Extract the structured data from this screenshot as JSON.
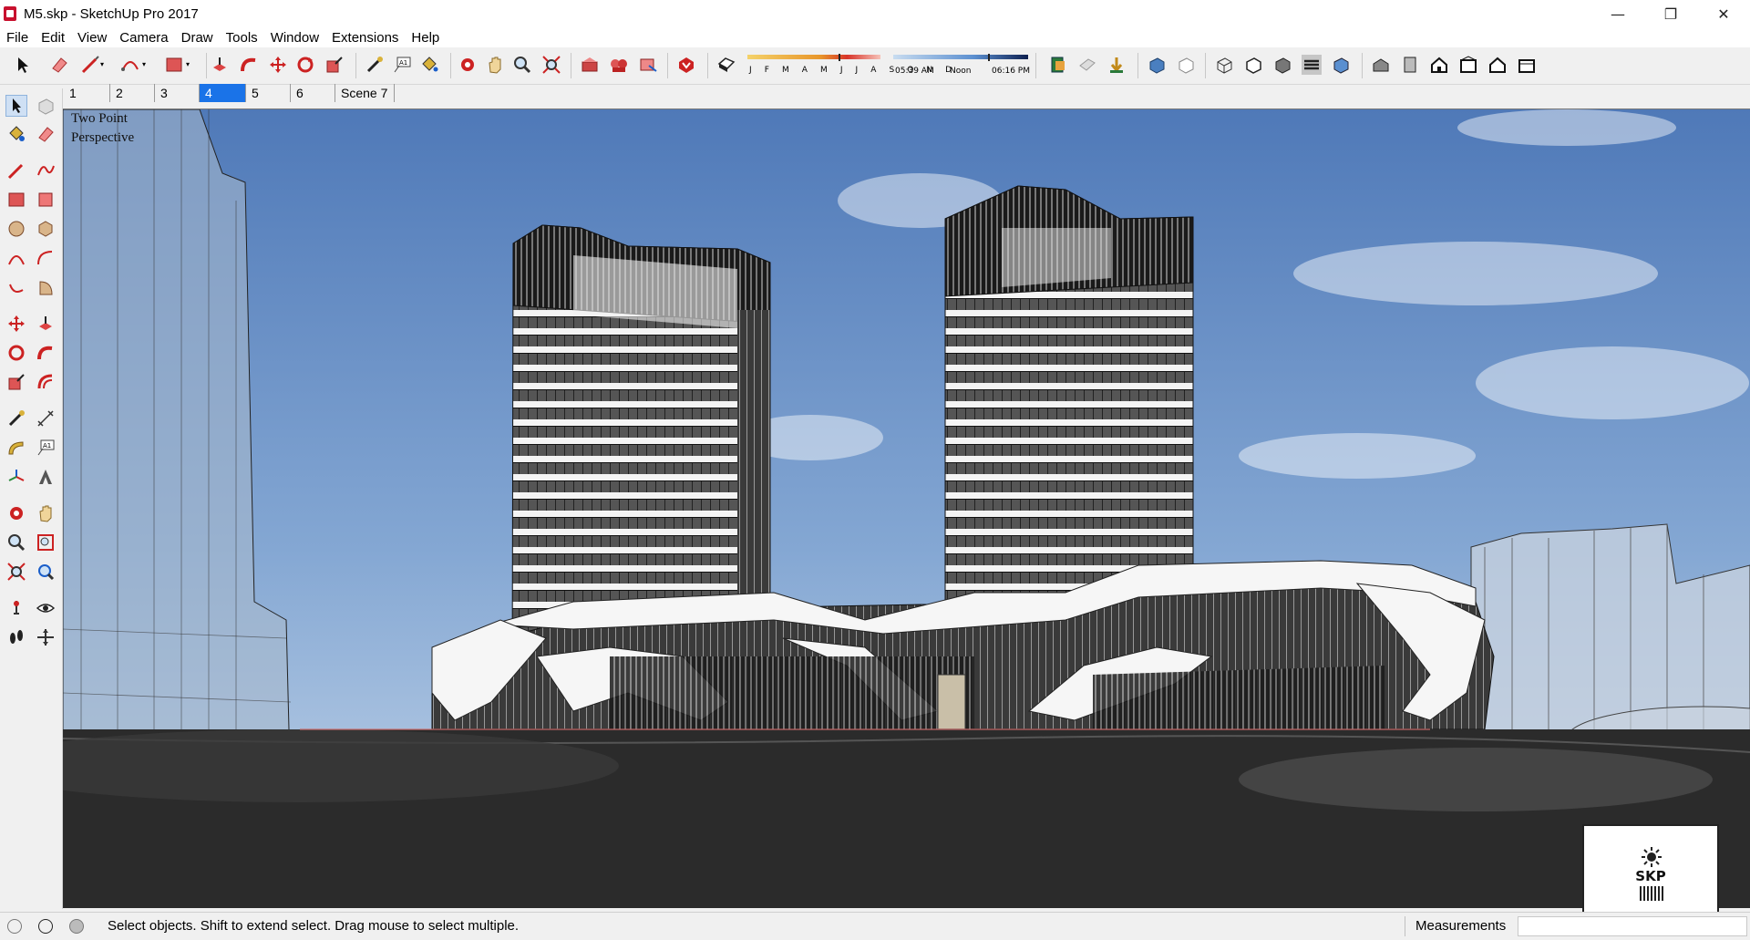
{
  "window": {
    "title": "M5.skp - SketchUp Pro 2017",
    "controls": [
      "—",
      "❐",
      "✕"
    ]
  },
  "menu": [
    "File",
    "Edit",
    "View",
    "Camera",
    "Draw",
    "Tools",
    "Window",
    "Extensions",
    "Help"
  ],
  "shadow": {
    "months": "J F M A M J J A S O N D",
    "time_start": "05:39 AM",
    "time_mid": "Noon",
    "time_end": "06:16 PM"
  },
  "scenes": {
    "tabs": [
      "1",
      "2",
      "3",
      "4",
      "5",
      "6",
      "Scene 7"
    ],
    "active": "4"
  },
  "viewport": {
    "camera_label_line1": "Two Point",
    "camera_label_line2": "Perspective"
  },
  "status": {
    "hint": "Select objects. Shift to extend select. Drag mouse to select multiple.",
    "measurements_label": "Measurements",
    "measurements_value": ""
  },
  "badge": {
    "text": "SKP"
  },
  "colors": {
    "accent": "#1a73e8",
    "sketchup_red": "#c8102e",
    "sky_top": "#4f79b8",
    "sky_bottom": "#b9cfe6",
    "ground": "#2b2b2b"
  }
}
